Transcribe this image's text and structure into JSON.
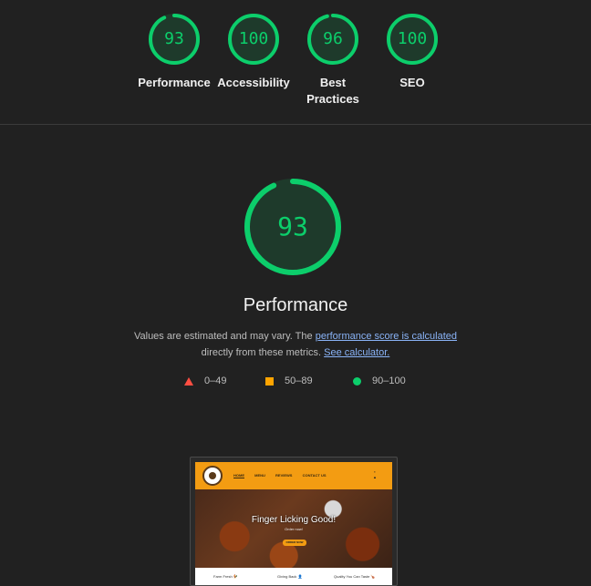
{
  "summary": {
    "gauges": [
      {
        "name": "performance",
        "score": "93",
        "label": "Performance",
        "value": 93
      },
      {
        "name": "accessibility",
        "score": "100",
        "label": "Accessibility",
        "value": 100
      },
      {
        "name": "best-practices",
        "score": "96",
        "label_line1": "Best",
        "label_line2": "Practices",
        "value": 96
      },
      {
        "name": "seo",
        "score": "100",
        "label": "SEO",
        "value": 100
      }
    ]
  },
  "main": {
    "score": "93",
    "score_value": 93,
    "title": "Performance",
    "desc_prefix": "Values are estimated and may vary. The ",
    "desc_link1": "performance score is calculated",
    "desc_mid": "directly from these metrics. ",
    "desc_link2": "See calculator."
  },
  "legend": {
    "fail": "0–49",
    "average": "50–89",
    "pass": "90–100"
  },
  "colors": {
    "pass": "#0cce6b",
    "average": "#ffa400",
    "fail": "#ff4e42",
    "background": "#212121"
  },
  "screenshot": {
    "nav": [
      "HOME",
      "MENU",
      "REVIEWS",
      "CONTACT US"
    ],
    "hero_title": "Finger Licking Good!",
    "hero_sub": "Order now!",
    "hero_button": "ORDER NOW",
    "features": [
      "Farm Fresh 🐓",
      "Giving Back 👤",
      "Quality You Can Taste 🍗"
    ]
  }
}
